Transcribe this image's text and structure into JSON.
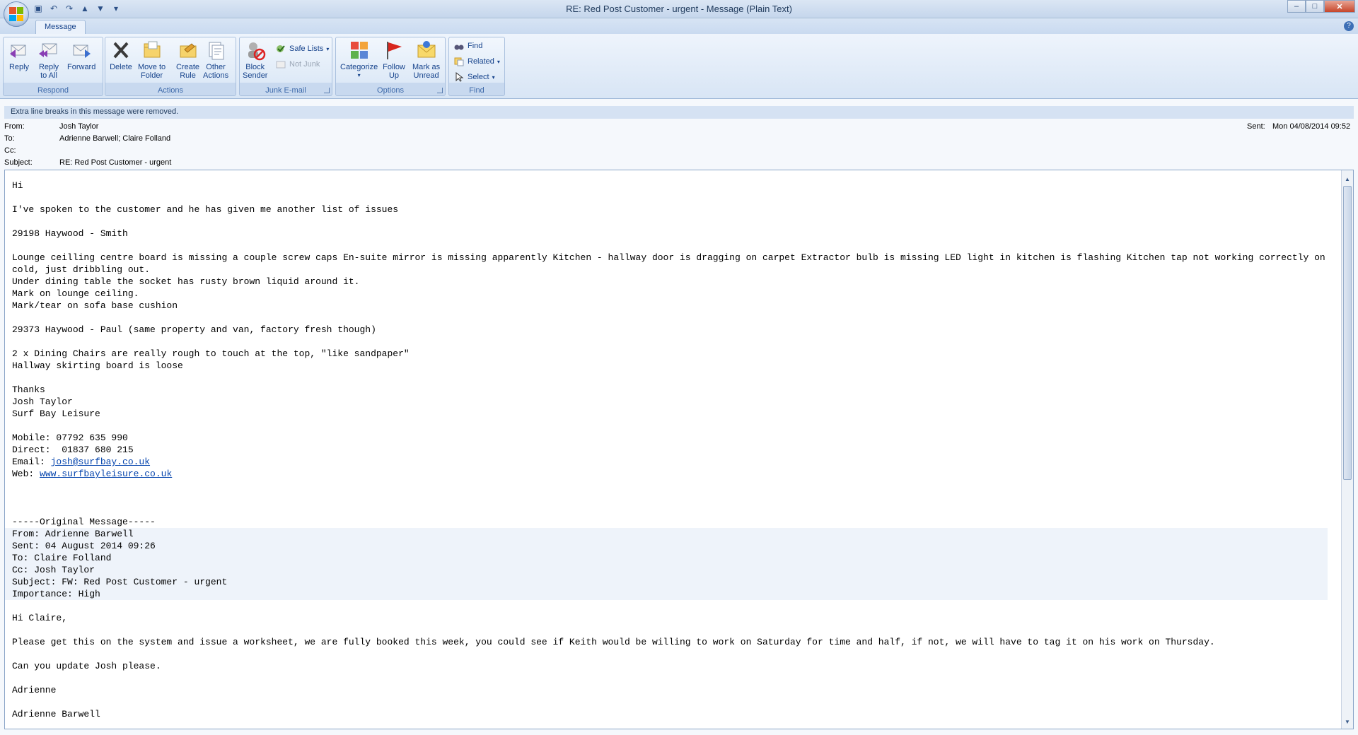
{
  "window": {
    "title": "RE: Red Post Customer - urgent - Message (Plain Text)"
  },
  "ribbon": {
    "tab": "Message",
    "groups": {
      "respond": "Respond",
      "actions": "Actions",
      "junk": "Junk E-mail",
      "options": "Options",
      "find": "Find"
    },
    "buttons": {
      "reply": "Reply",
      "reply_all_1": "Reply",
      "reply_all_2": "to All",
      "forward": "Forward",
      "delete": "Delete",
      "move_1": "Move to",
      "move_2": "Folder",
      "create_1": "Create",
      "create_2": "Rule",
      "other_1": "Other",
      "other_2": "Actions",
      "block_1": "Block",
      "block_2": "Sender",
      "safe_lists": "Safe Lists",
      "not_junk": "Not Junk",
      "categorize": "Categorize",
      "follow_1": "Follow",
      "follow_2": "Up",
      "mark_1": "Mark as",
      "mark_2": "Unread",
      "find": "Find",
      "related": "Related",
      "select": "Select"
    }
  },
  "infobar": "Extra line breaks in this message were removed.",
  "header": {
    "from_label": "From:",
    "from": "Josh Taylor",
    "to_label": "To:",
    "to": "Adrienne Barwell; Claire Folland",
    "cc_label": "Cc:",
    "cc": "",
    "subject_label": "Subject:",
    "subject": "RE: Red Post Customer - urgent",
    "sent_label": "Sent:",
    "sent": "Mon 04/08/2014 09:52"
  },
  "body": {
    "part1": "Hi\n\nI've spoken to the customer and he has given me another list of issues\n\n29198 Haywood - Smith\n\nLounge ceilling centre board is missing a couple screw caps En-suite mirror is missing apparently Kitchen - hallway door is dragging on carpet Extractor bulb is missing LED light in kitchen is flashing Kitchen tap not working correctly on cold, just dribbling out.\nUnder dining table the socket has rusty brown liquid around it.\nMark on lounge ceiling.\nMark/tear on sofa base cushion\n\n29373 Haywood - Paul (same property and van, factory fresh though)\n\n2 x Dining Chairs are really rough to touch at the top, \"like sandpaper\"\nHallway skirting board is loose\n\nThanks\nJosh Taylor\nSurf Bay Leisure\n\nMobile: 07792 635 990\nDirect:  01837 680 215\nEmail: ",
    "email_link": "josh@surfbay.co.uk",
    "web_prefix": "\nWeb: ",
    "web_link": "www.surfbayleisure.co.uk",
    "part2": "\n\n\n\n-----Original Message-----\n",
    "quote_header": "From: Adrienne Barwell\nSent: 04 August 2014 09:26\nTo: Claire Folland\nCc: Josh Taylor\nSubject: FW: Red Post Customer - urgent\nImportance: High",
    "part3": "\nHi Claire,\n\nPlease get this on the system and issue a worksheet, we are fully booked this week, you could see if Keith would be willing to work on Saturday for time and half, if not, we will have to tag it on his work on Thursday.\n\nCan you update Josh please.\n\nAdrienne\n\nAdrienne Barwell"
  }
}
